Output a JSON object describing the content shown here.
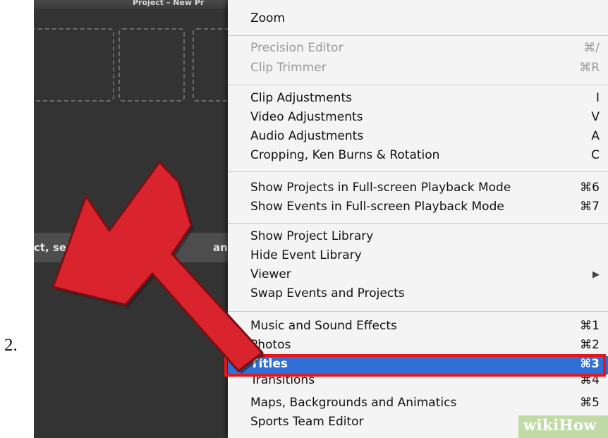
{
  "step_number": "2.",
  "background": {
    "project_title": "Project – New Pr",
    "hint_left": "ct, selec",
    "hint_right": "an"
  },
  "menu": {
    "items": [
      {
        "label": "Zoom",
        "shortcut": ""
      },
      {
        "label": "Precision Editor",
        "shortcut": "⌘/"
      },
      {
        "label": "Clip Trimmer",
        "shortcut": "⌘R"
      },
      {
        "label": "Clip Adjustments",
        "shortcut": "I"
      },
      {
        "label": "Video Adjustments",
        "shortcut": "V"
      },
      {
        "label": "Audio Adjustments",
        "shortcut": "A"
      },
      {
        "label": "Cropping, Ken Burns & Rotation",
        "shortcut": "C"
      },
      {
        "label": "Show Projects in Full-screen Playback Mode",
        "shortcut": "⌘6"
      },
      {
        "label": "Show Events in Full-screen Playback Mode",
        "shortcut": "⌘7"
      },
      {
        "label": "Show Project Library",
        "shortcut": ""
      },
      {
        "label": "Hide Event Library",
        "shortcut": ""
      },
      {
        "label": "Viewer",
        "shortcut": "▶"
      },
      {
        "label": "Swap Events and Projects",
        "shortcut": ""
      },
      {
        "label": "Music and Sound Effects",
        "shortcut": "⌘1"
      },
      {
        "label": "Photos",
        "shortcut": "⌘2"
      },
      {
        "label": "Titles",
        "shortcut": "⌘3"
      },
      {
        "label": "Transitions",
        "shortcut": "⌘4"
      },
      {
        "label": "Maps, Backgrounds and Animatics",
        "shortcut": "⌘5"
      },
      {
        "label": "Sports Team Editor",
        "shortcut": ""
      }
    ]
  },
  "selected_item": "Titles",
  "colors": {
    "selection": "#2f6fd6",
    "highlight_box": "#e3161c",
    "arrow": "#d9232d"
  },
  "watermark": "wikiHow"
}
